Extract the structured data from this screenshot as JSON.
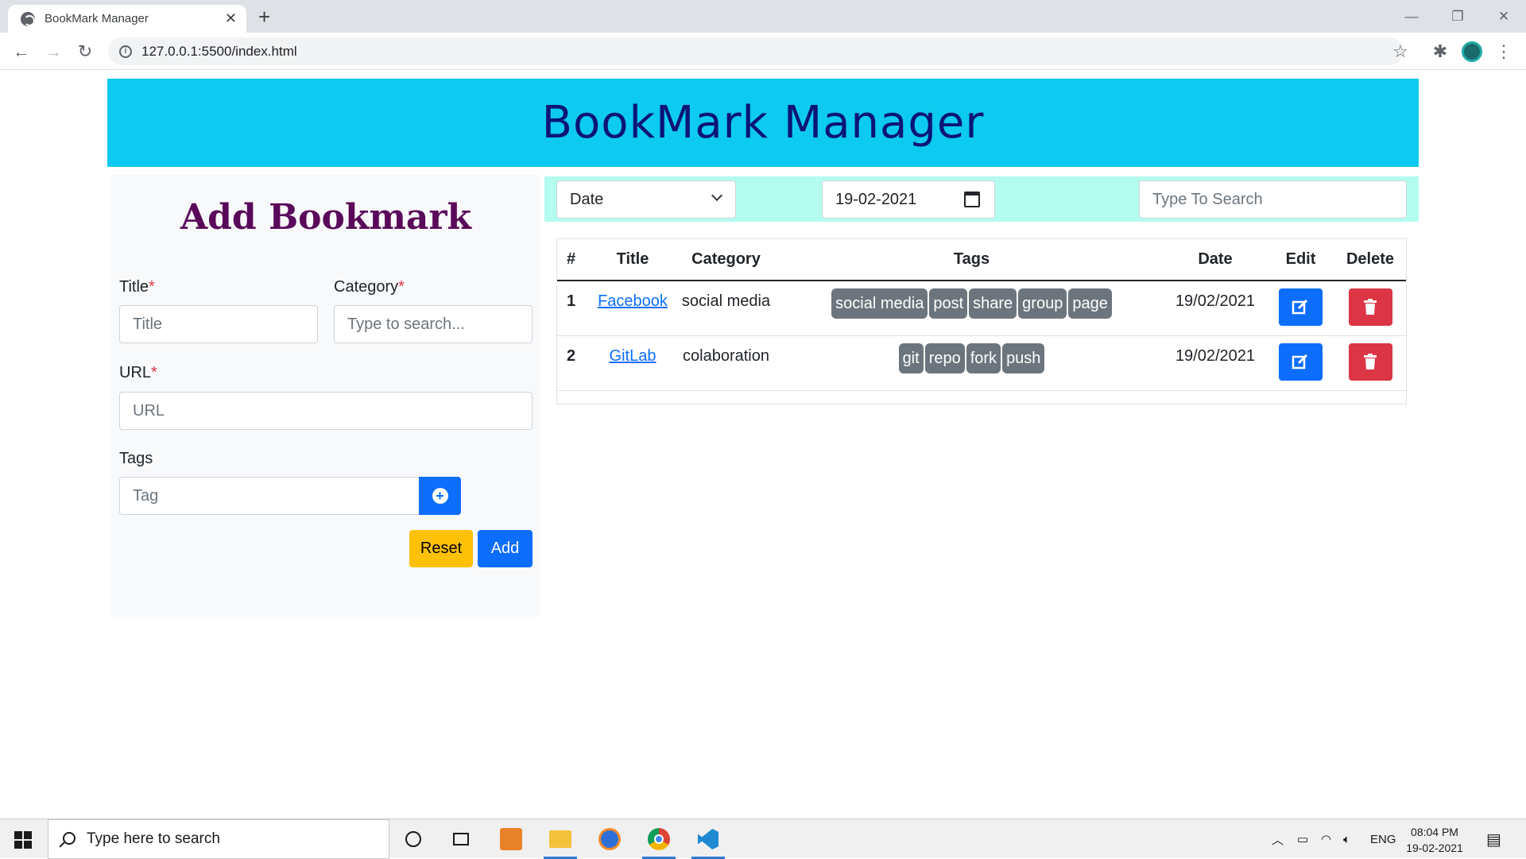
{
  "browser": {
    "tab_title": "BookMark Manager",
    "url": "127.0.0.1:5500/index.html"
  },
  "header": {
    "title": "BookMark Manager"
  },
  "form": {
    "heading": "Add Bookmark",
    "title_label": "Title",
    "title_placeholder": "Title",
    "category_label": "Category",
    "category_placeholder": "Type to search...",
    "url_label": "URL",
    "url_placeholder": "URL",
    "tags_label": "Tags",
    "tag_placeholder": "Tag",
    "required_mark": "*",
    "reset_label": "Reset",
    "add_label": "Add"
  },
  "filters": {
    "sort_value": "Date",
    "date_value": "19-02-2021",
    "search_placeholder": "Type To Search"
  },
  "table": {
    "headers": [
      "#",
      "Title",
      "Category",
      "Tags",
      "Date",
      "Edit",
      "Delete"
    ],
    "rows": [
      {
        "num": "1",
        "title": "Facebook",
        "category": "social media",
        "tags": [
          "social media",
          "post",
          "share",
          "group",
          "page"
        ],
        "date": "19/02/2021"
      },
      {
        "num": "2",
        "title": "GitLab",
        "category": "colaboration",
        "tags": [
          "git",
          "repo",
          "fork",
          "push"
        ],
        "date": "19/02/2021"
      }
    ]
  },
  "taskbar": {
    "search_placeholder": "Type here to search",
    "lang": "ENG",
    "time": "08:04 PM",
    "date": "19-02-2021"
  },
  "colors": {
    "header_bg": "#0dcaf0",
    "header_text": "#0b1577",
    "toolbar_bg": "#b4fcf0",
    "primary": "#0d6efd",
    "danger": "#dc3545",
    "warning": "#ffc107",
    "badge": "#6c757d"
  }
}
